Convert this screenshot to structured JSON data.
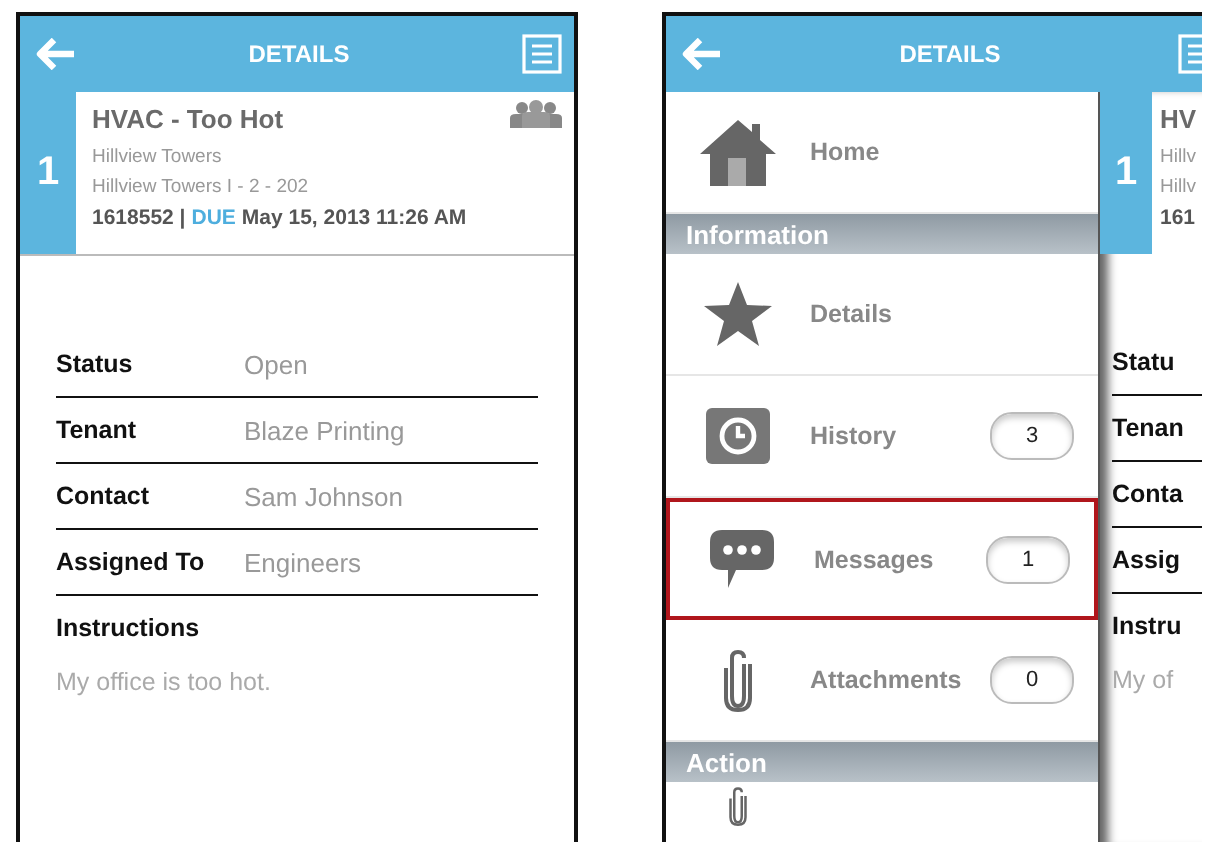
{
  "screens": [
    {
      "kind": "detail",
      "header": {
        "title": "DETAILS"
      },
      "work_order": {
        "number": "1",
        "title": "HVAC - Too Hot",
        "building": "Hillview Towers",
        "unit": "Hillview Towers I - 2 - 202",
        "id": "1618552 |",
        "due_label": "DUE",
        "due": "May 15, 2013 11:26 AM"
      },
      "fields": [
        {
          "label": "Status",
          "value": "Open"
        },
        {
          "label": "Tenant",
          "value": "Blaze Printing"
        },
        {
          "label": "Contact",
          "value": "Sam Johnson"
        },
        {
          "label": "Assigned To",
          "value": "Engineers"
        }
      ],
      "instructions": {
        "label": "Instructions",
        "text": "My office is too hot."
      }
    },
    {
      "kind": "menu",
      "header": {
        "title": "DETAILS"
      },
      "menu": [
        {
          "kind": "item",
          "label": "Home",
          "selected": false
        },
        {
          "kind": "section",
          "label": "Information"
        },
        {
          "kind": "item",
          "label": "Details",
          "selected": false
        },
        {
          "kind": "item",
          "label": "History",
          "badge": "3",
          "selected": false
        },
        {
          "kind": "item",
          "label": "Messages",
          "badge": "1",
          "selected": true
        },
        {
          "kind": "item",
          "label": "Attachments",
          "badge": "0",
          "selected": false
        },
        {
          "kind": "section",
          "label": "Action"
        },
        {
          "kind": "partial"
        }
      ],
      "peek": {
        "number": "1",
        "lines": [
          "HV",
          "Hillv",
          "Hillv",
          "161"
        ],
        "fields": [
          "Statu",
          "Tenan",
          "Conta",
          "Assig",
          "Instru"
        ],
        "text": "My of"
      }
    }
  ]
}
